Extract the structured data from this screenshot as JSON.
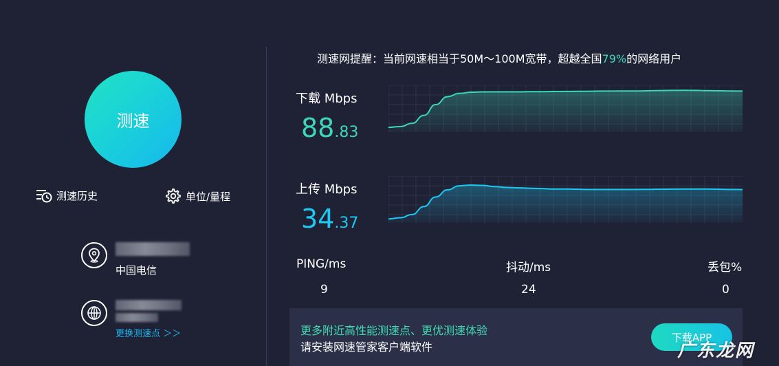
{
  "start_button": {
    "label": "测速"
  },
  "tools": {
    "history_label": "测速历史",
    "unit_label": "单位/量程"
  },
  "isp": {
    "name": "中国电信"
  },
  "node": {
    "switch_label": "更换测速点 ＞＞"
  },
  "notice": {
    "prefix": "测速网提醒：当前网速相当于50M～100M宽带，超越全国",
    "percent": "79%",
    "suffix": "的网络用户"
  },
  "download": {
    "label": "下载 Mbps",
    "value_int": "88",
    "value_dec": ".83",
    "color": "#3dd8b3",
    "curve": [
      0.05,
      0.07,
      0.15,
      0.35,
      0.62,
      0.82,
      0.9,
      0.93,
      0.94,
      0.94,
      0.94,
      0.94,
      0.945,
      0.945,
      0.948,
      0.95,
      0.952,
      0.955,
      0.958,
      0.96,
      0.962,
      0.962,
      0.966,
      0.972,
      0.976,
      0.978,
      0.976,
      0.97,
      0.965,
      0.962,
      0.958
    ]
  },
  "upload": {
    "label": "上传 Mbps",
    "value_int": "34",
    "value_dec": ".37",
    "color": "#1ec8f2",
    "curve": [
      0.03,
      0.06,
      0.14,
      0.34,
      0.58,
      0.76,
      0.86,
      0.88,
      0.87,
      0.84,
      0.82,
      0.81,
      0.8,
      0.79,
      0.78,
      0.78,
      0.775,
      0.77,
      0.77,
      0.77,
      0.77,
      0.77,
      0.772,
      0.775,
      0.778,
      0.78,
      0.78,
      0.78,
      0.775,
      0.77,
      0.768
    ]
  },
  "stats": {
    "ping_label": "PING/ms",
    "ping_value": "9",
    "jitter_label": "抖动/ms",
    "jitter_value": "24",
    "loss_label": "丢包%",
    "loss_value": "0"
  },
  "promo": {
    "line1": "更多附近高性能测速点、更优测速体验",
    "line2": "请安装网速管家客户端软件",
    "button_label": "下载APP"
  },
  "watermark": "广东龙网"
}
